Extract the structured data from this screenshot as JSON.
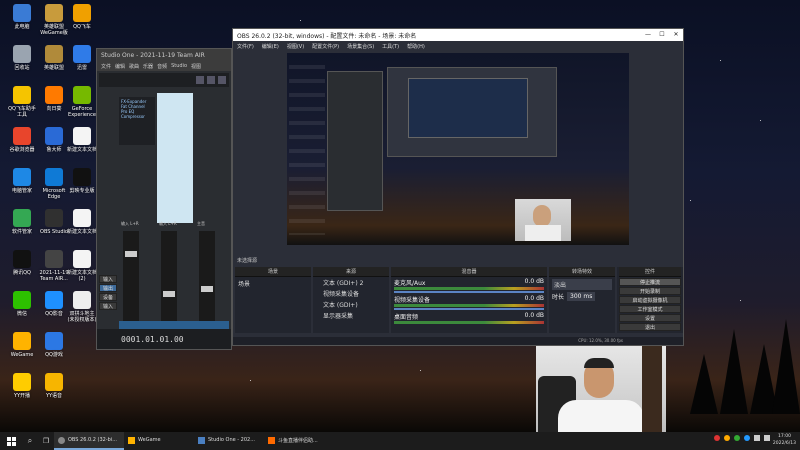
{
  "desktop": {
    "icons": [
      {
        "label": "此电脑",
        "color": "#3a7bd5"
      },
      {
        "label": "回收站",
        "color": "#9aa4b0"
      },
      {
        "label": "QQ飞车助手工具",
        "color": "#f5c400"
      },
      {
        "label": "谷歌浏览器",
        "color": "#e8452c"
      },
      {
        "label": "电脑管家",
        "color": "#1e88e5"
      },
      {
        "label": "软件管家",
        "color": "#34a853"
      },
      {
        "label": "腾讯QQ",
        "color": "#111"
      },
      {
        "label": "微信",
        "color": "#2dc100"
      },
      {
        "label": "WeGame",
        "color": "#ffb300"
      },
      {
        "label": "YY开播",
        "color": "#ffcc00"
      },
      {
        "label": "英雄联盟 WeGame版",
        "color": "#c89b3c"
      },
      {
        "label": "英雄联盟",
        "color": "#b08a3a"
      },
      {
        "label": "向日葵",
        "color": "#ff7a00"
      },
      {
        "label": "鲁大师",
        "color": "#2a6ad6"
      },
      {
        "label": "Microsoft Edge",
        "color": "#0f7ad6"
      },
      {
        "label": "OBS Studio",
        "color": "#303030"
      },
      {
        "label": "2021-11-19 Team AIR...",
        "color": "#444"
      },
      {
        "label": "QQ影音",
        "color": "#1e90ff"
      },
      {
        "label": "QQ游戏",
        "color": "#2c78e4"
      },
      {
        "label": "YY语音",
        "color": "#f7b500"
      },
      {
        "label": "QQ飞车",
        "color": "#f0a000"
      },
      {
        "label": "迅雷",
        "color": "#2f7be8"
      },
      {
        "label": "GeForce Experience",
        "color": "#76b900"
      },
      {
        "label": "新建文本文档",
        "color": "#f4f4f4"
      },
      {
        "label": "剪映专业版",
        "color": "#111"
      },
      {
        "label": "新建文本文档",
        "color": "#f4f4f4"
      },
      {
        "label": "新建文本文档(2)",
        "color": "#f4f4f4"
      },
      {
        "label": "双拼斗地主 (未授权版本)",
        "color": "#eee"
      }
    ]
  },
  "studio_one": {
    "title": "Studio One - 2021-11-19 Team AIR",
    "menu": [
      "文件",
      "编辑",
      "歌曲",
      "乐器",
      "音频",
      "Studio",
      "视图",
      "帮助",
      "选项",
      "帮助"
    ],
    "sidebar": [
      "输入",
      "输出",
      "设备",
      "输入"
    ],
    "channel_labels": [
      "输入 L+R",
      "输入 L+R",
      "主音"
    ],
    "timecode": "0001.01.01.00",
    "fx": [
      "FX-Expander",
      "Fat Channel",
      "Pro EQ",
      "Compressor"
    ]
  },
  "obs": {
    "title": "OBS 26.0.2 (32-bit, windows) - 配置文件: 未命名 - 场景: 未命名",
    "menu": [
      "文件(F)",
      "编辑(E)",
      "视图(V)",
      "配置文件(P)",
      "场景集合(S)",
      "工具(T)",
      "帮助(H)"
    ],
    "preview_label": "未选择源",
    "docks": {
      "scenes": {
        "title": "场景",
        "items": [
          "场景"
        ]
      },
      "sources": {
        "title": "来源",
        "items": [
          "文本 (GDI+) 2",
          "视频采集设备",
          "文本 (GDI+)",
          "显示器采集"
        ]
      },
      "mixer": {
        "title": "混音器",
        "channels": [
          {
            "name": "麦克风/Aux",
            "db": "0.0 dB"
          },
          {
            "name": "视频采集设备",
            "db": "0.0 dB"
          },
          {
            "name": "桌面音频",
            "db": "0.0 dB"
          }
        ]
      },
      "transitions": {
        "title": "转场特效",
        "type": "淡出",
        "duration_label": "时长",
        "duration": "300 ms"
      },
      "controls": {
        "title": "控件",
        "buttons": [
          "停止推流",
          "开始录制",
          "启动虚拟摄像机",
          "工作室模式",
          "设置",
          "退出"
        ]
      }
    },
    "status": "CPU: 12.0%, 30.00 fps"
  },
  "taskbar": {
    "items": [
      {
        "label": "OBS 26.0.2 (32-bi...",
        "active": true
      },
      {
        "label": "WeGame",
        "active": false
      },
      {
        "label": "Studio One - 202...",
        "active": false
      },
      {
        "label": "斗鱼直播伴侣助...",
        "active": false
      }
    ],
    "time": "17:00",
    "date": "2022/6/13"
  }
}
